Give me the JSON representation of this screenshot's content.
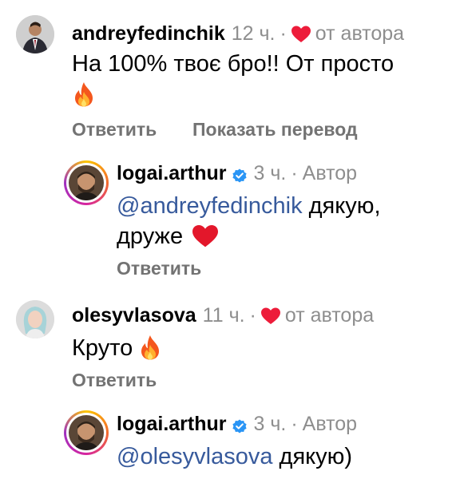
{
  "comments": [
    {
      "username": "andreyfedinchik",
      "time": "12 ч.",
      "separator": "·",
      "liked_label": "от автора",
      "text_line1": "На 100% твоє бро!! От просто",
      "reply_label": "Ответить",
      "translate_label": "Показать перевод",
      "reply": {
        "username": "logai.arthur",
        "time": "3 ч.",
        "separator": "·",
        "author_label": "Автор",
        "mention": "@andreyfedinchik",
        "text_after": " дякую,",
        "text_line2": "друже",
        "reply_label": "Ответить"
      }
    },
    {
      "username": "olesyvlasova",
      "time": "11 ч.",
      "separator": "·",
      "liked_label": "от автора",
      "text": "Круто",
      "reply_label": "Ответить",
      "reply": {
        "username": "logai.arthur",
        "time": "3 ч.",
        "separator": "·",
        "author_label": "Автор",
        "mention": "@olesyvlasova",
        "text_after": " дякую)"
      }
    }
  ],
  "colors": {
    "heart": "#ed1c3a",
    "verified": "#2a95f5",
    "mention": "#375a9c",
    "secondary": "#8e8e8e"
  }
}
